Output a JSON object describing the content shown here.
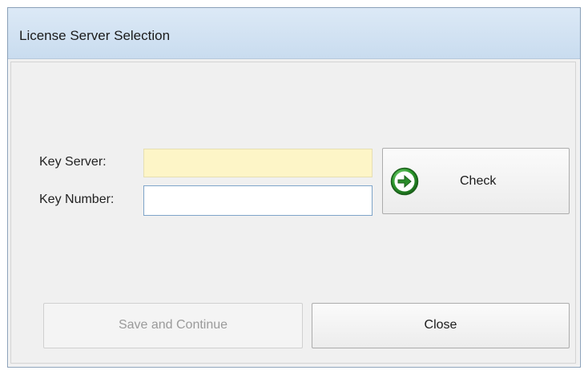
{
  "window": {
    "title": "License Server Selection"
  },
  "form": {
    "key_server": {
      "label": "Key Server:",
      "value": "",
      "placeholder": ""
    },
    "key_number": {
      "label": "Key Number:",
      "value": "",
      "placeholder": ""
    }
  },
  "buttons": {
    "check_label": "Check",
    "check_icon": "green-right-arrow-icon",
    "save_label": "Save and Continue",
    "save_enabled": false,
    "close_label": "Close"
  },
  "colors": {
    "key_server_field_bg": "#fdf5c7",
    "check_icon_green": "#2e9a2e",
    "titlebar_blue": "#d3e3f3"
  }
}
